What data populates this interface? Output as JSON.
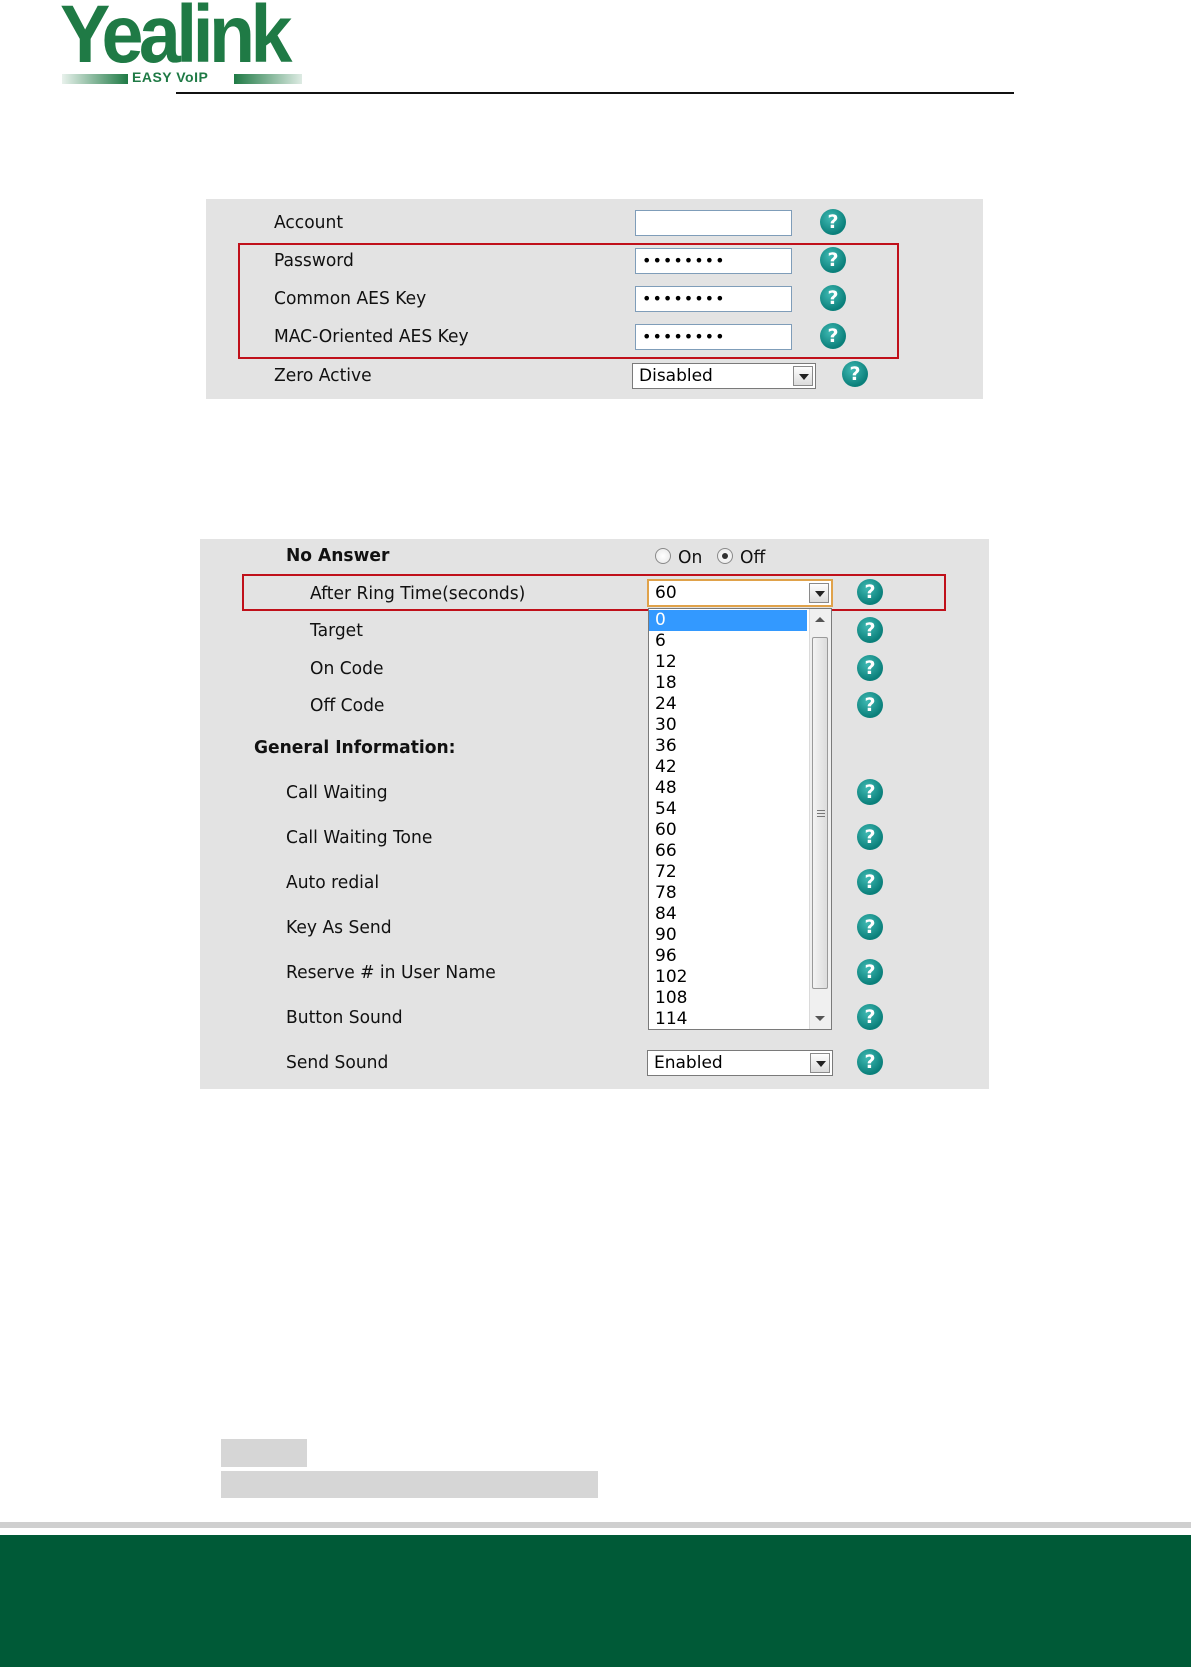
{
  "logo": {
    "word": "Yealink",
    "tagline": "EASY VoIP"
  },
  "panel1": {
    "rows": [
      {
        "label": "Account",
        "value": ""
      },
      {
        "label": "Password",
        "value": "••••••••"
      },
      {
        "label": "Common AES Key",
        "value": "••••••••"
      },
      {
        "label": "MAC-Oriented AES Key",
        "value": "••••••••"
      }
    ],
    "zero_active": {
      "label": "Zero Active",
      "value": "Disabled"
    },
    "help_glyph": "?"
  },
  "panel2": {
    "no_answer": {
      "label": "No Answer",
      "on": "On",
      "off": "Off"
    },
    "after_ring": {
      "label": "After Ring Time(seconds)",
      "value": "60"
    },
    "target": "Target",
    "on_code": "On Code",
    "off_code": "Off Code",
    "general_heading": "General Information:",
    "call_waiting": "Call Waiting",
    "call_waiting_tone": "Call Waiting Tone",
    "auto_redial": "Auto redial",
    "key_as_send": "Key As Send",
    "reserve": "Reserve # in User Name",
    "button_sound": "Button Sound",
    "send_sound": {
      "label": "Send Sound",
      "value": "Enabled"
    },
    "dropdown_options": [
      "0",
      "6",
      "12",
      "18",
      "24",
      "30",
      "36",
      "42",
      "48",
      "54",
      "60",
      "66",
      "72",
      "78",
      "84",
      "90",
      "96",
      "102",
      "108",
      "114"
    ],
    "highlighted_option": "0",
    "help_glyph": "?"
  },
  "colors": {
    "brand_green": "#005a37",
    "logo_green": "#1f7a45",
    "highlight_box": "#c0101a",
    "help_icon": "#0a7f7a",
    "list_highlight": "#3399ff"
  }
}
